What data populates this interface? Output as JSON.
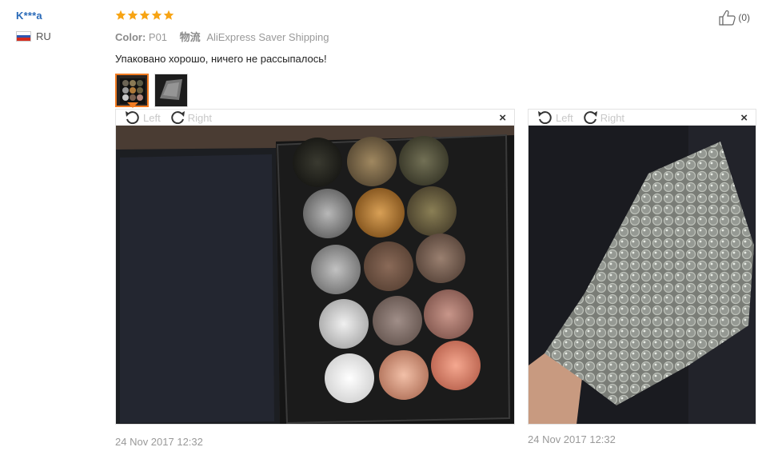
{
  "user": {
    "name": "K***a",
    "country_code": "RU"
  },
  "rating": {
    "stars": 5,
    "color": "#f7a414"
  },
  "meta": {
    "color_label": "Color:",
    "color_value": "P01",
    "shipping_label": "物流",
    "shipping_value": "AliExpress Saver Shipping"
  },
  "comment": "Упаковано хорошо, ничего не рассыпалось!",
  "like": {
    "icon": "thumbs-up-icon",
    "count": "(0)"
  },
  "viewers": [
    {
      "left_label": "Left",
      "right_label": "Right",
      "close": "×",
      "date": "24 Nov 2017 12:32"
    },
    {
      "left_label": "Left",
      "right_label": "Right",
      "close": "×",
      "date": "24 Nov 2017 12:32"
    }
  ],
  "colors": {
    "accent": "#f07b22",
    "link": "#2a6ab8"
  }
}
